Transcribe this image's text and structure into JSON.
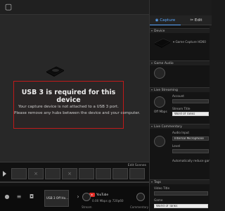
{
  "preview": {
    "error_title": "USB 3 is required for this device",
    "error_line1": "Your capture device is not attached to a USB 3 port.",
    "error_line2": "Please remove any hubs between the device and your computer."
  },
  "timeline": {
    "edit_scenes": "Edit Scenes"
  },
  "bottom": {
    "card_label": "USB 3 Off Ho...",
    "yt_label": "YouTube",
    "stream_info": "0.00 Mbps @ 720p60",
    "stream_label": "Stream",
    "commentary_label": "Commentary"
  },
  "panel": {
    "tab_capture": "Capture",
    "tab_edit": "Edit",
    "device_section": "Device",
    "device_name": "Game Capture HD60",
    "game_audio_section": "Game Audio",
    "live_streaming_section": "Live Streaming",
    "account_label": "Account",
    "knob_label": "Off Mbps",
    "stream_title_label": "Stream Title",
    "stream_title_value": "Word of Tanks",
    "live_commentary_section": "Live Commentary",
    "audio_input_label": "Audio Input",
    "audio_input_value": "Internal Microphone",
    "level_label": "Level",
    "auto_adjust": "Automatically reduce gam",
    "tags_section": "Tags",
    "video_title_label": "Video Title",
    "game_label": "Game",
    "game_value": "World of Tanks"
  },
  "colors": {
    "error_border": "#c11a1a",
    "capture_tab": "#5aa8ff",
    "youtube_red": "#e52d27"
  }
}
